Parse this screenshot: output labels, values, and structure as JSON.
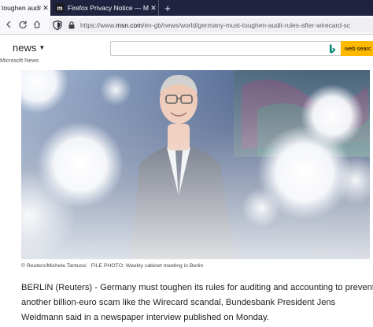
{
  "tabs": [
    {
      "label": "toughen audit r",
      "active": true
    },
    {
      "label": "Firefox Privacy Notice — Mozil",
      "active": false,
      "icon": "mozilla-m-icon"
    }
  ],
  "new_tab_symbol": "+",
  "address_bar": {
    "url_prefix": "https://www.",
    "url_domain": "msn.com",
    "url_path": "/en-gb/news/world/germany-must-toughen-audit-rules-after-wirecard-sc"
  },
  "msn": {
    "section": "news",
    "sub_brand": "Microsoft News",
    "search_placeholder": "",
    "search_button": "web searc"
  },
  "photo": {
    "credit": "© Reuters/Michele Tantussi",
    "caption": "FILE PHOTO: Weekly cabinet meeting in Berlin"
  },
  "article": {
    "lines": [
      "BERLIN (Reuters) - Germany must toughen its rules for auditing and accounting to prevent",
      "another billion-euro scam like the Wirecard scandal, Bundesbank President Jens",
      "Weidmann said in a newspaper interview published on Monday."
    ]
  },
  "colors": {
    "tabstrip": "#202340",
    "search_button": "#ffb900",
    "link": "#0066cc"
  }
}
